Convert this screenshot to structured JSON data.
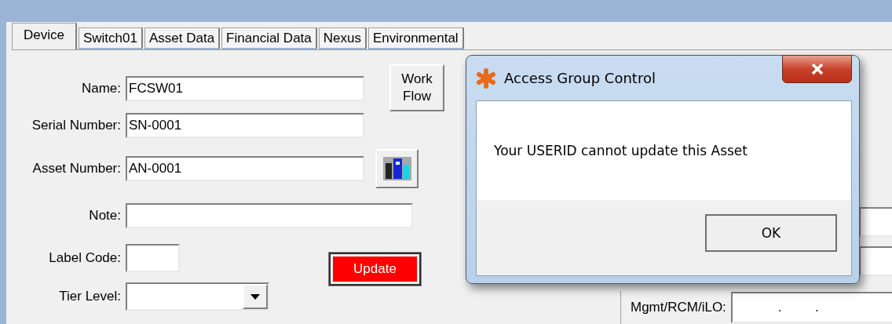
{
  "tabs": [
    {
      "label": "Device",
      "selected": true
    },
    {
      "label": "Switch01",
      "selected": false
    },
    {
      "label": "Asset Data",
      "selected": false
    },
    {
      "label": "Financial Data",
      "selected": false
    },
    {
      "label": "Nexus",
      "selected": false
    },
    {
      "label": "Environmental",
      "selected": false
    }
  ],
  "form": {
    "name": {
      "label": "Name:",
      "value": "FCSW01"
    },
    "work_flow_button": [
      "Work",
      "Flow"
    ],
    "serial_number": {
      "label": "Serial Number:",
      "value": "SN-0001"
    },
    "asset_number": {
      "label": "Asset Number:",
      "value": "AN-0001"
    },
    "note": {
      "label": "Note:"
    },
    "label_code": {
      "label": "Label Code:"
    },
    "update_button": "Update",
    "tier_level": {
      "label": "Tier Level:"
    }
  },
  "right_panel": {
    "mgmt": {
      "label": "Mgmt/RCM/iLO:",
      "value": ".         ."
    }
  },
  "dialog": {
    "title": "Access Group Control",
    "message": "Your USERID cannot update this Asset",
    "buttons": [
      "OK"
    ]
  }
}
